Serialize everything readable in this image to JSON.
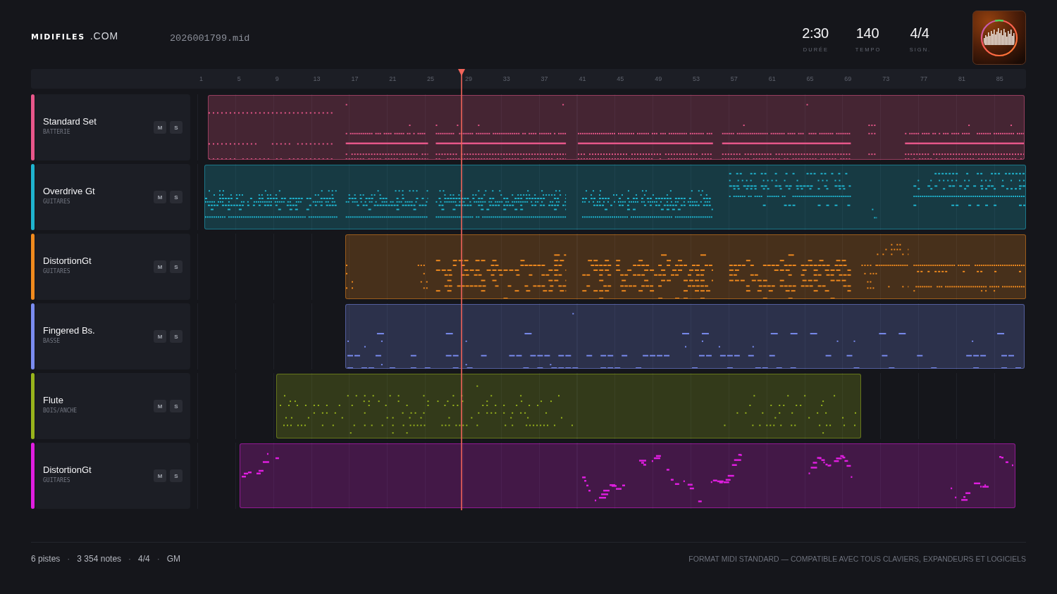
{
  "header": {
    "logo": {
      "name": "MIDIFILES",
      "suffix": ".COM"
    },
    "filename": "2026001799.mid",
    "stats": [
      {
        "value": "2:30",
        "label": "DURÉE"
      },
      {
        "value": "140",
        "label": "TEMPO"
      },
      {
        "value": "4/4",
        "label": "SIGN."
      }
    ]
  },
  "ruler": {
    "labels": [
      "1",
      "5",
      "9",
      "13",
      "17",
      "21",
      "25",
      "29",
      "33",
      "37",
      "41",
      "45",
      "49",
      "53",
      "57",
      "61",
      "65",
      "69",
      "73",
      "77",
      "81",
      "85"
    ]
  },
  "playhead": {
    "level": 0.319
  },
  "tracks": [
    {
      "name": "Standard Set",
      "category": "BATTERIE",
      "color": "#e8578a",
      "buttons": [
        {
          "label": "M",
          "on": false
        },
        {
          "label": "S",
          "on": false
        }
      ]
    },
    {
      "name": "Overdrive Gt",
      "category": "GUITARES",
      "color": "#1fb4cf",
      "buttons": [
        {
          "label": "M",
          "on": false
        },
        {
          "label": "S",
          "on": false
        }
      ]
    },
    {
      "name": "DistortionGt",
      "category": "GUITARES",
      "color": "#f08a1e",
      "buttons": [
        {
          "label": "M",
          "on": false
        },
        {
          "label": "S",
          "on": false
        }
      ]
    },
    {
      "name": "Fingered Bs.",
      "category": "BASSE",
      "color": "#7a8cf0",
      "buttons": [
        {
          "label": "M",
          "on": false
        },
        {
          "label": "S",
          "on": false
        }
      ]
    },
    {
      "name": "Flute",
      "category": "BOIS/ANCHE",
      "color": "#98b41c",
      "buttons": [
        {
          "label": "M",
          "on": false
        },
        {
          "label": "S",
          "on": false
        }
      ]
    },
    {
      "name": "DistortionGt",
      "category": "GUITARES",
      "color": "#e01ee0",
      "buttons": [
        {
          "label": "M",
          "on": false
        },
        {
          "label": "S",
          "on": false
        }
      ]
    }
  ],
  "footer": {
    "items": [
      {
        "kind": "text",
        "text": "6 pistes"
      },
      {
        "kind": "separator",
        "text": "·"
      },
      {
        "kind": "text",
        "text": "3 354 notes"
      },
      {
        "kind": "separator",
        "text": "·"
      },
      {
        "kind": "text",
        "text": "4/4"
      },
      {
        "kind": "separator",
        "text": "·"
      },
      {
        "kind": "text",
        "text": "GM"
      }
    ],
    "note": "FORMAT MIDI STANDARD — COMPATIBLE AVEC TOUS CLAVIERS, EXPANDEURS ET LOGICIELS"
  }
}
